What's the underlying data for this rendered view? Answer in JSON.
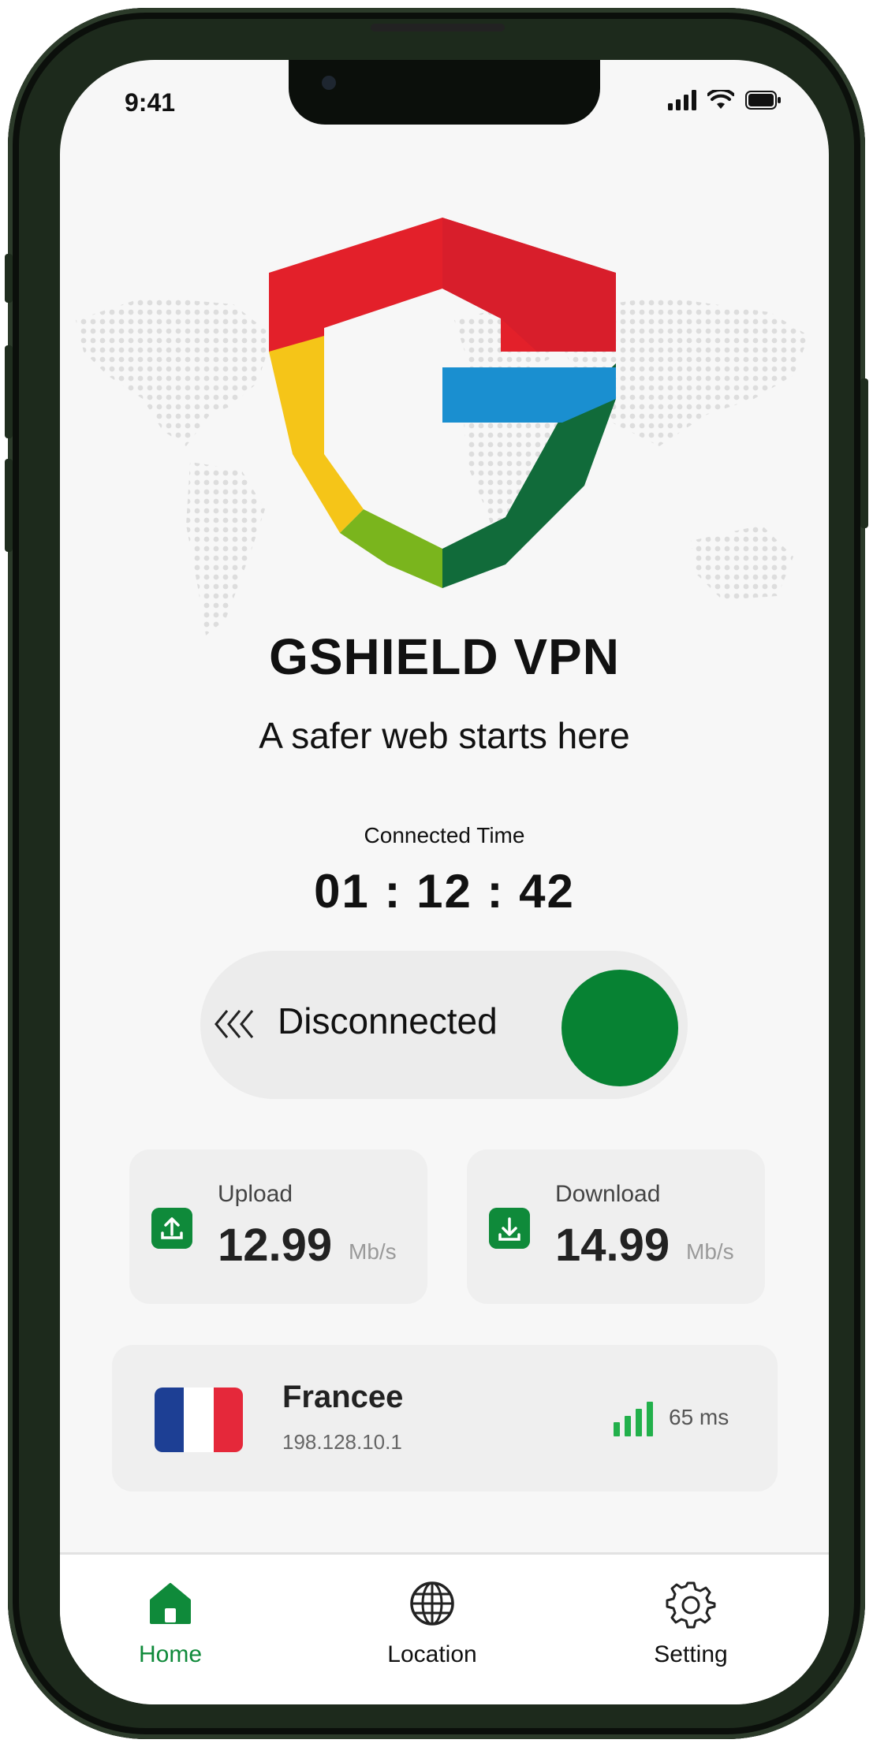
{
  "status_bar": {
    "time": "9:41"
  },
  "app": {
    "title": "GSHIELD VPN",
    "tagline": "A safer web starts here"
  },
  "connection": {
    "time_label": "Connected Time",
    "time_value": "01 : 12 : 42",
    "toggle_label": "Disconnected"
  },
  "stats": {
    "upload": {
      "title": "Upload",
      "value": "12.99",
      "unit": "Mb/s"
    },
    "download": {
      "title": "Download",
      "value": "14.99",
      "unit": "Mb/s"
    }
  },
  "server": {
    "country": "Francee",
    "ip": "198.128.10.1",
    "ping": "65 ms"
  },
  "nav": {
    "items": [
      {
        "label": "Home",
        "icon": "home-icon",
        "active": true
      },
      {
        "label": "Location",
        "icon": "globe-icon",
        "active": false
      },
      {
        "label": "Setting",
        "icon": "gear-icon",
        "active": false
      }
    ]
  },
  "colors": {
    "accent": "#078233",
    "frame": "#1d2a1c",
    "logo_red": "#e3202a",
    "logo_yellow": "#f5c518",
    "logo_green_light": "#7ab51d",
    "logo_green_dark": "#116b3a",
    "logo_blue": "#1a8fd0",
    "flag_blue": "#1d3f94",
    "flag_red": "#e5283a"
  }
}
